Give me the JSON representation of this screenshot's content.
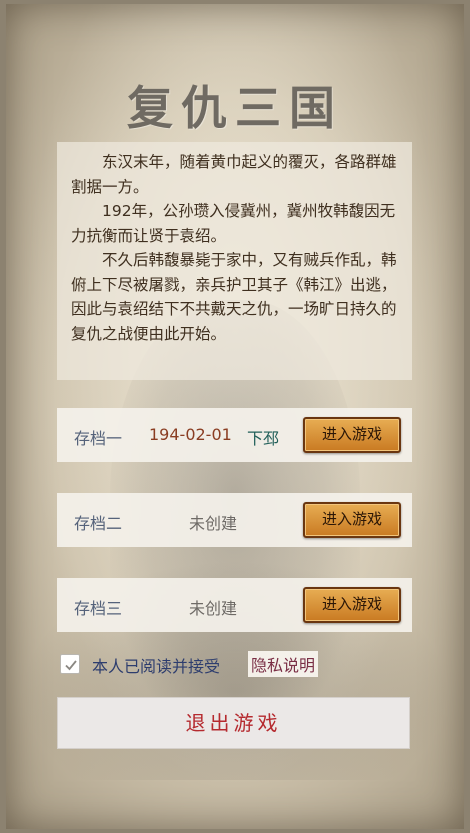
{
  "title": "复仇三国",
  "story": {
    "paragraphs": [
      "东汉末年，随着黄巾起义的覆灭，各路群雄割据一方。",
      "192年，公孙瓒入侵冀州，冀州牧韩馥因无力抗衡而让贤于袁绍。",
      "不久后韩馥暴毙于家中，又有贼兵作乱，韩俯上下尽被屠戮，亲兵护卫其子《韩江》出逃，因此与袁绍结下不共戴天之仇，一场旷日持久的复仇之战便由此开始。"
    ]
  },
  "slots": [
    {
      "label": "存档一",
      "date": "194-02-01",
      "city": "下邳",
      "button": "进入游戏"
    },
    {
      "label": "存档二",
      "status": "未创建",
      "button": "进入游戏"
    },
    {
      "label": "存档三",
      "status": "未创建",
      "button": "进入游戏"
    }
  ],
  "agreement": {
    "checked": true,
    "text": "本人已阅读并接受",
    "link": "隐私说明"
  },
  "exit_button": "退出游戏",
  "colors": {
    "button_orange": "#d48a2e",
    "exit_text": "#b52a2f",
    "story_text": "#3f2f1f"
  }
}
